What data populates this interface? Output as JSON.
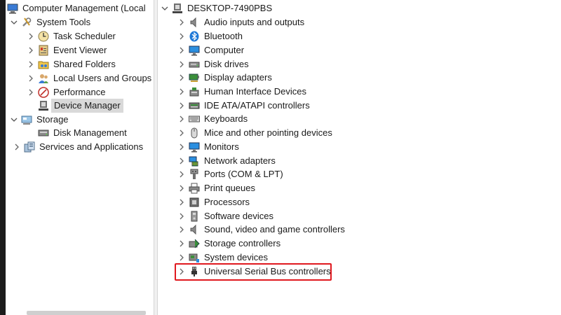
{
  "left_tree": {
    "root": {
      "label": "Computer Management (Local",
      "icon": "computer-management-icon"
    },
    "system_tools": {
      "label": "System Tools",
      "icon": "tools-icon"
    },
    "items": [
      {
        "label": "Task Scheduler",
        "icon": "clock-icon"
      },
      {
        "label": "Event Viewer",
        "icon": "event-viewer-icon"
      },
      {
        "label": "Shared Folders",
        "icon": "shared-folder-icon"
      },
      {
        "label": "Local Users and Groups",
        "icon": "users-icon"
      },
      {
        "label": "Performance",
        "icon": "performance-icon"
      },
      {
        "label": "Device Manager",
        "icon": "device-manager-icon",
        "selected": true
      }
    ],
    "storage": {
      "label": "Storage",
      "icon": "storage-icon"
    },
    "disk_management": {
      "label": "Disk Management",
      "icon": "disk-icon"
    },
    "services": {
      "label": "Services and Applications",
      "icon": "services-icon"
    }
  },
  "device_tree": {
    "root": {
      "label": "DESKTOP-7490PBS",
      "icon": "desktop-icon"
    },
    "categories": [
      {
        "label": "Audio inputs and outputs",
        "icon": "speaker-icon"
      },
      {
        "label": "Bluetooth",
        "icon": "bluetooth-icon"
      },
      {
        "label": "Computer",
        "icon": "monitor-icon"
      },
      {
        "label": "Disk drives",
        "icon": "disk-drive-icon"
      },
      {
        "label": "Display adapters",
        "icon": "display-adapter-icon"
      },
      {
        "label": "Human Interface Devices",
        "icon": "hid-icon"
      },
      {
        "label": "IDE ATA/ATAPI controllers",
        "icon": "ide-controller-icon"
      },
      {
        "label": "Keyboards",
        "icon": "keyboard-icon"
      },
      {
        "label": "Mice and other pointing devices",
        "icon": "mouse-icon"
      },
      {
        "label": "Monitors",
        "icon": "monitor-icon"
      },
      {
        "label": "Network adapters",
        "icon": "network-adapter-icon"
      },
      {
        "label": "Ports (COM & LPT)",
        "icon": "port-icon"
      },
      {
        "label": "Print queues",
        "icon": "printer-icon"
      },
      {
        "label": "Processors",
        "icon": "processor-icon"
      },
      {
        "label": "Software devices",
        "icon": "software-device-icon"
      },
      {
        "label": "Sound, video and game controllers",
        "icon": "speaker-icon"
      },
      {
        "label": "Storage controllers",
        "icon": "storage-controller-icon"
      },
      {
        "label": "System devices",
        "icon": "system-device-icon"
      },
      {
        "label": "Universal Serial Bus controllers",
        "icon": "usb-icon",
        "highlighted": true
      }
    ]
  },
  "colors": {
    "highlight": "#e0191f",
    "selection": "#d9d9d9",
    "icon_blue": "#1e78d7"
  }
}
